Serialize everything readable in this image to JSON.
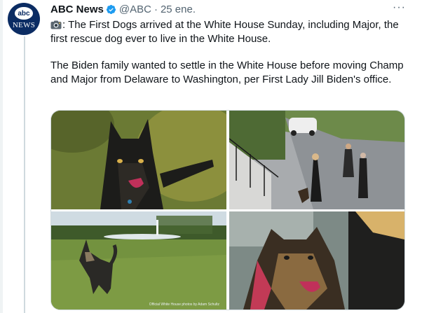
{
  "tweet": {
    "author_name": "ABC News",
    "handle": "@ABC",
    "separator": "·",
    "date": "25 ene.",
    "more_label": "···",
    "paragraph_1": ": The First Dogs arrived at the White House Sunday, including Major, the first rescue dog ever to live in the White House.",
    "paragraph_2": "The Biden family wanted to settle in the White House before moving Champ and Major from Delaware to Washington, per First Lady Jill Biden's office."
  },
  "avatar": {
    "logo_text": "abc",
    "sub_text": "NEWS"
  },
  "media": {
    "photo_credit": "Official White House photos by Adam Schultz"
  },
  "colors": {
    "text": "#0f1419",
    "muted": "#536471",
    "verified": "#1d9bf0",
    "border": "#cfd9de",
    "avatar_bg": "#0b2c63"
  },
  "icons": {
    "verified": "verified-badge-icon",
    "camera": "camera-emoji-icon",
    "more": "more-options-icon"
  }
}
